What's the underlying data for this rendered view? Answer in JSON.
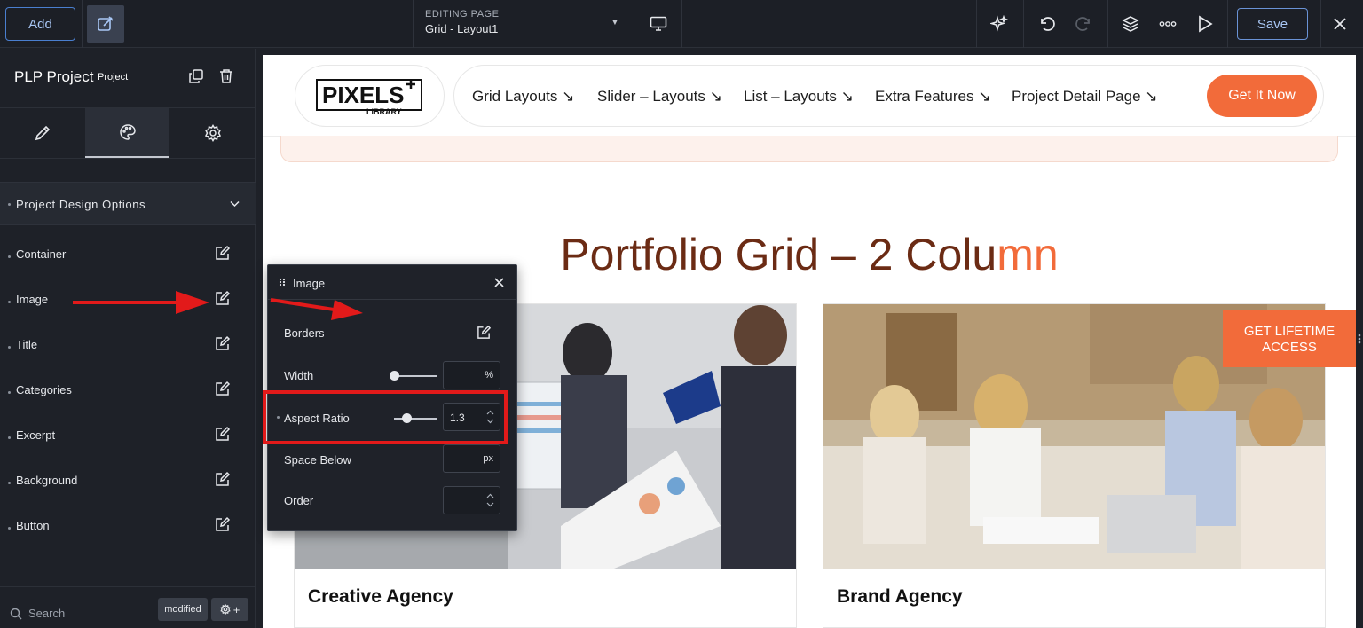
{
  "topbar": {
    "add_label": "Add",
    "editing_label": "EDITING PAGE",
    "page_name": "Grid - Layout1",
    "save_label": "Save"
  },
  "sidebar": {
    "project_title": "PLP Project",
    "project_badge": "Project",
    "section_title": "Project Design Options",
    "options": [
      {
        "label": "Container"
      },
      {
        "label": "Image"
      },
      {
        "label": "Title"
      },
      {
        "label": "Categories"
      },
      {
        "label": "Excerpt"
      },
      {
        "label": "Background"
      },
      {
        "label": "Button"
      }
    ],
    "search_placeholder": "Search",
    "modified_label": "modified"
  },
  "site": {
    "logo_main": "PIXELS",
    "logo_sub": "LIBRARY",
    "nav": [
      {
        "label": "Grid Layouts ↘"
      },
      {
        "label": "Slider – Layouts ↘"
      },
      {
        "label": "List – Layouts ↘"
      },
      {
        "label": "Extra Features ↘"
      },
      {
        "label": "Project Detail Page ↘"
      }
    ],
    "cta_label": "Get It Now",
    "heading_main": "Portfolio Grid – 2 Colu",
    "heading_accent": "mn",
    "cards": [
      {
        "title": "Creative Agency"
      },
      {
        "title": "Brand Agency"
      }
    ],
    "lifetime_line1": "GET LIFETIME",
    "lifetime_line2": "ACCESS"
  },
  "popup": {
    "title": "Image",
    "rows": {
      "borders": "Borders",
      "width": "Width",
      "width_unit": "%",
      "aspect_ratio": "Aspect Ratio",
      "aspect_value": "1.3",
      "space_below": "Space Below",
      "space_unit": "px",
      "order": "Order"
    }
  },
  "colors": {
    "accent": "#f26b3a",
    "heading": "#6b2b14",
    "annotation_red": "#e21a1a",
    "panel_bg": "#1e2128"
  }
}
